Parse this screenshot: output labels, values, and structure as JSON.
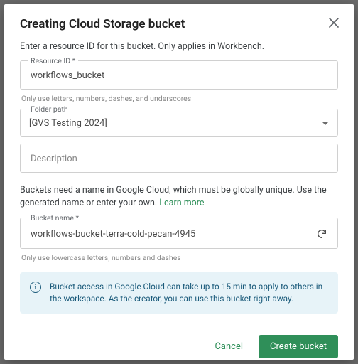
{
  "dialog": {
    "title": "Creating Cloud Storage bucket",
    "intro": "Enter a resource ID for this bucket. Only applies in Workbench."
  },
  "resource_id": {
    "label": "Resource ID *",
    "value": "workflows_bucket",
    "helper": "Only use letters, numbers, dashes, and underscores"
  },
  "folder_path": {
    "label": "Folder path",
    "selected": "[GVS Testing 2024]"
  },
  "description": {
    "placeholder": "Description",
    "value": ""
  },
  "naming": {
    "text": "Buckets need a name in Google Cloud, which must be globally unique. Use the generated name or enter your own.",
    "learn_more": "Learn more"
  },
  "bucket_name": {
    "label": "Bucket name *",
    "value": "workflows-bucket-terra-cold-pecan-4945",
    "helper": "Only use lowercase letters, numbers and dashes"
  },
  "alert": {
    "message": "Bucket access in Google Cloud can take up to 15 min to apply to others in the workspace. As the creator, you can use this bucket right away."
  },
  "buttons": {
    "cancel": "Cancel",
    "create": "Create bucket"
  }
}
